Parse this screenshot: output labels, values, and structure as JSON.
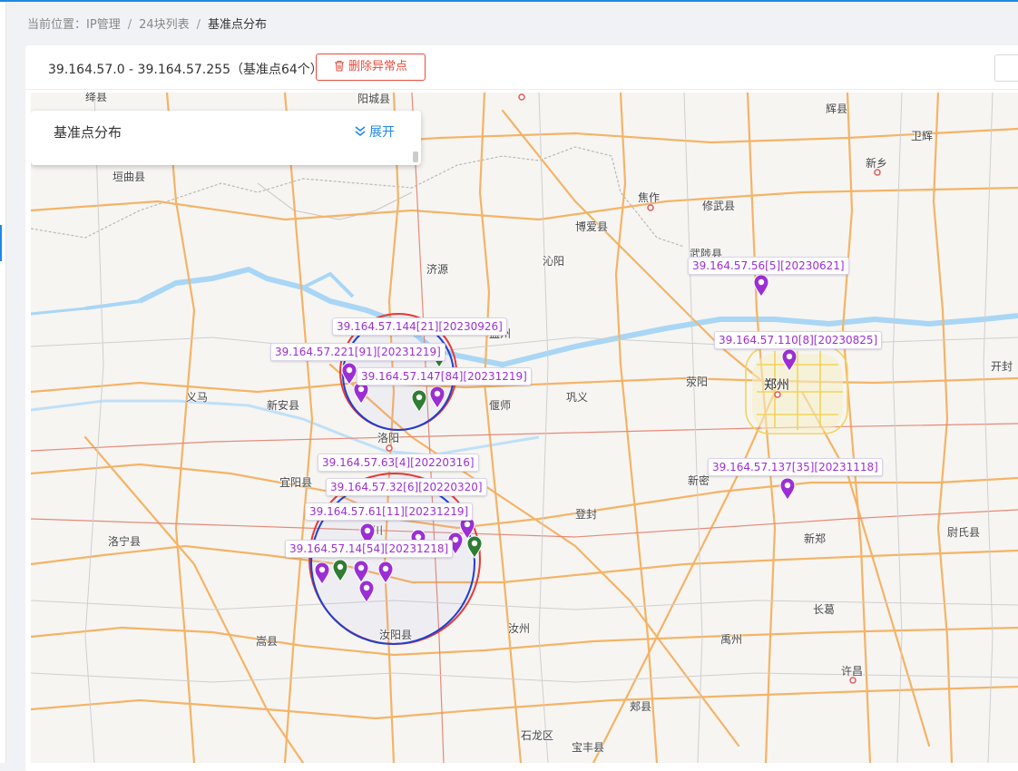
{
  "breadcrumb": {
    "prefix": "当前位置：",
    "items": [
      "IP管理",
      "24块列表",
      "基准点分布"
    ],
    "separator": "/"
  },
  "header": {
    "range_text": "39.164.57.0 - 39.164.57.255（基准点64个）",
    "delete_label": "删除异常点"
  },
  "panel": {
    "title": "基准点分布",
    "expand_label": "展开"
  },
  "map": {
    "places": [
      "绛县",
      "阳城县",
      "辉县",
      "卫辉",
      "垣曲县",
      "新乡",
      "焦作",
      "修武县",
      "博爱县",
      "沁阳",
      "济源",
      "武陟县",
      "孟州",
      "开封",
      "郑州",
      "荥阳",
      "义马",
      "新安县",
      "偃师",
      "巩义",
      "洛阳",
      "宜阳县",
      "新密",
      "登封",
      "洛宁县",
      "伊川",
      "新郑",
      "尉氏县",
      "长葛",
      "嵩县",
      "汝阳县",
      "汝州",
      "禹州",
      "许昌",
      "郏县",
      "石龙区",
      "宝丰县"
    ],
    "markers": [
      {
        "label": "39.164.57.56[5][20230621]",
        "color": "purple"
      },
      {
        "label": "39.164.57.110[8][20230825]",
        "color": "purple"
      },
      {
        "label": "39.164.57.137[35][20231118]",
        "color": "purple"
      },
      {
        "label": "39.164.57.144[21][20230926]",
        "color": "purple"
      },
      {
        "label": "39.164.57.221[91][20231219]",
        "color": "purple"
      },
      {
        "label": "39.164.57.147[84][20231219]",
        "color": "purple"
      },
      {
        "label": "39.164.57.63[4][20220316]",
        "color": "purple"
      },
      {
        "label": "39.164.57.32[6][20220320]",
        "color": "purple"
      },
      {
        "label": "39.164.57.61[11][20231219]",
        "color": "purple"
      },
      {
        "label": "39.164.57.14[54][20231218]",
        "color": "purple"
      }
    ]
  },
  "colors": {
    "accent": "#1e88e5",
    "danger": "#e74c3c",
    "marker_purple": "#9b2fd4",
    "marker_green": "#2e7d32",
    "circle_red": "#e53935",
    "circle_blue": "#1f3fd1",
    "river": "#a9d6f5",
    "road": "#f5b366"
  }
}
